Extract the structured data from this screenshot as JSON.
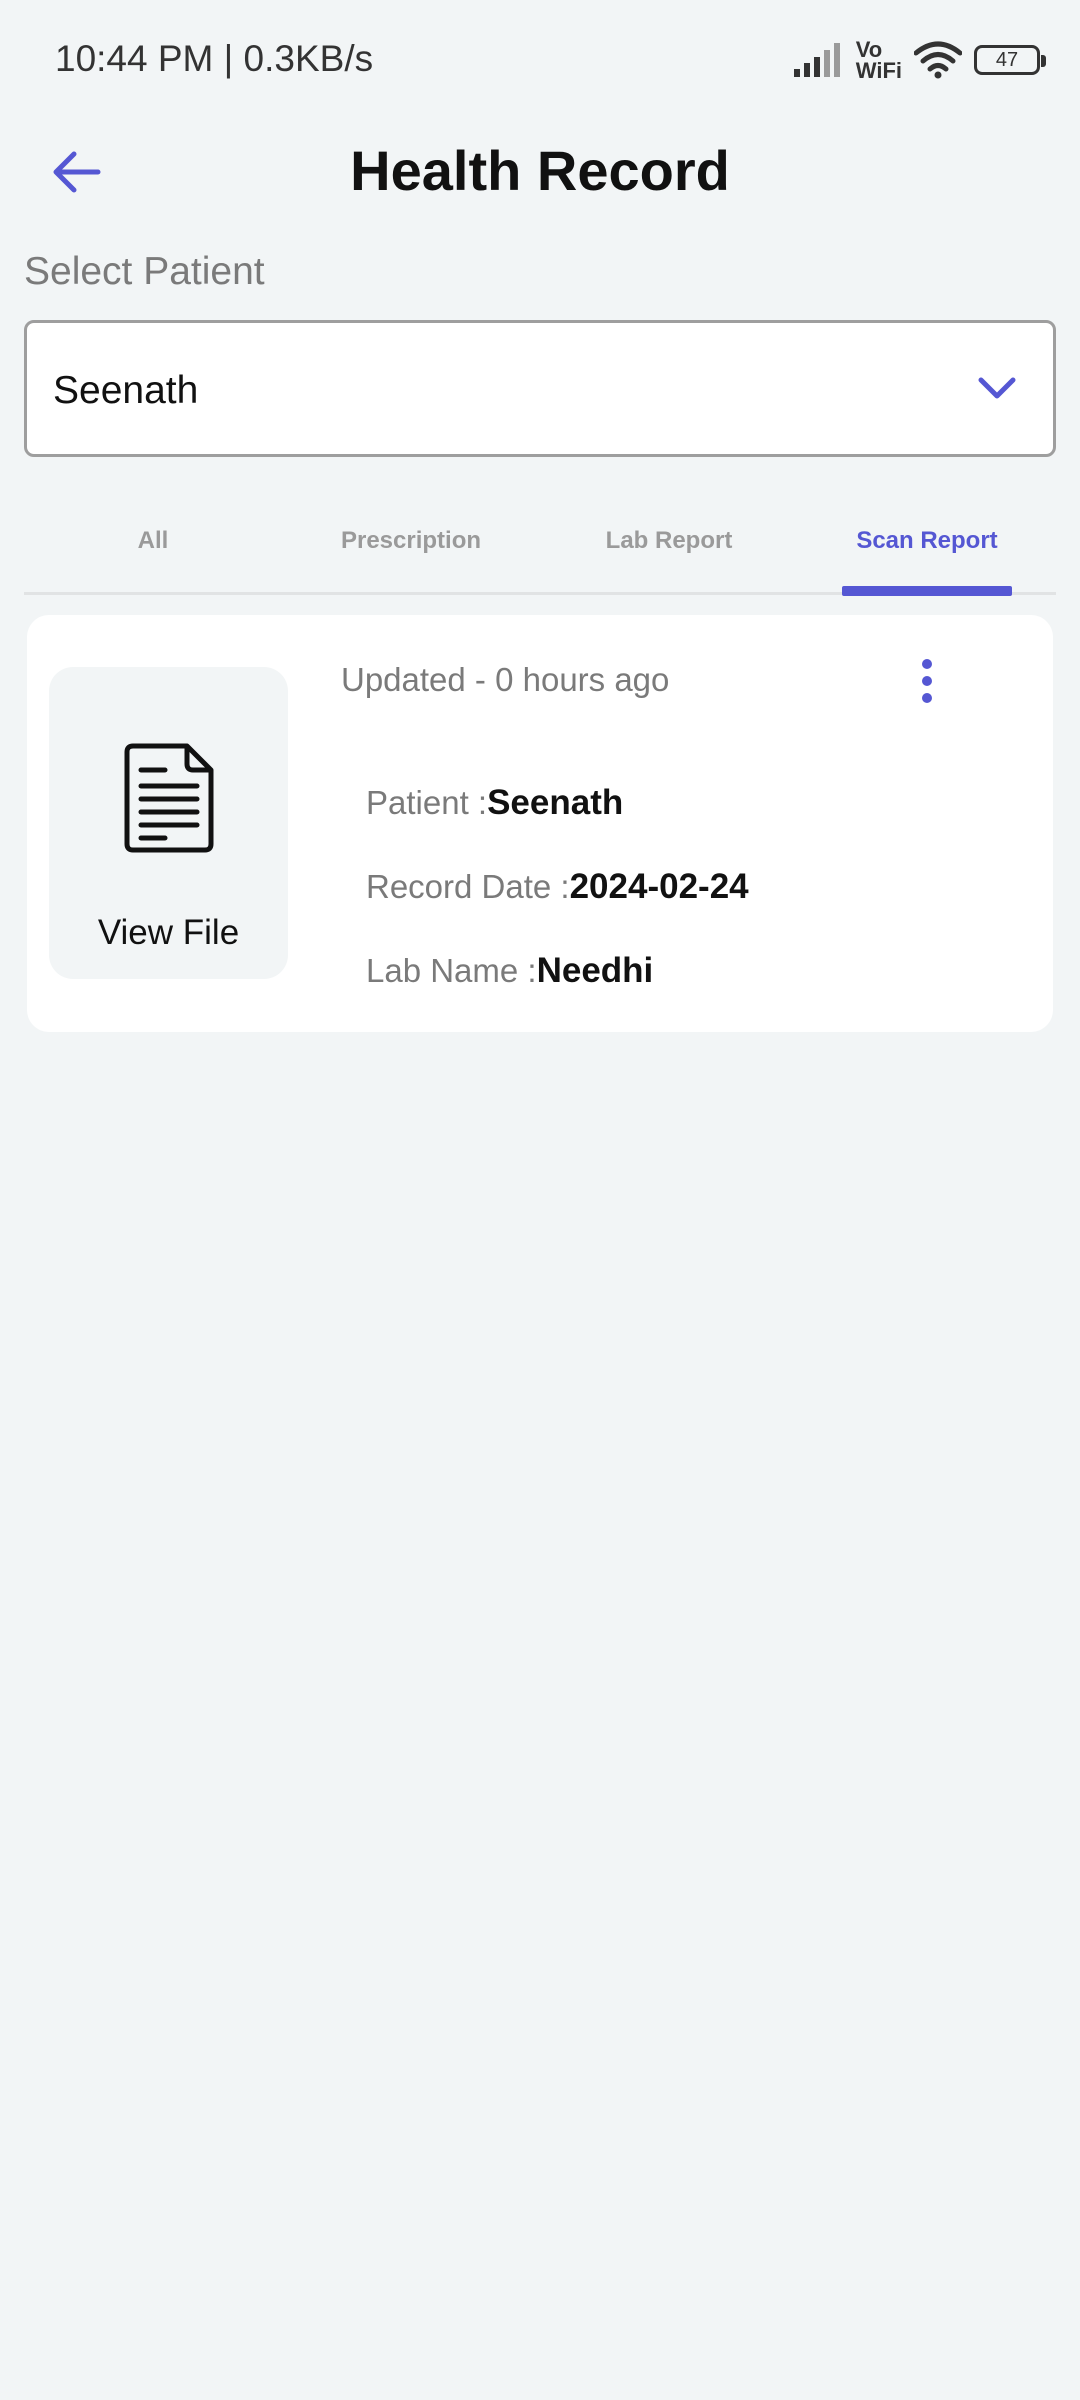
{
  "status_bar": {
    "time": "10:44 PM | 0.3KB/s",
    "vowifi_top": "Vo",
    "vowifi_bottom": "WiFi",
    "battery": "47"
  },
  "header": {
    "title": "Health Record",
    "back_icon": "arrow-left-icon"
  },
  "patient_select": {
    "label": "Select Patient",
    "selected": "Seenath",
    "icon": "chevron-down-icon"
  },
  "tabs": [
    {
      "label": "All"
    },
    {
      "label": "Prescription"
    },
    {
      "label": "Lab Report"
    },
    {
      "label": "Scan Report"
    }
  ],
  "active_tab": "Scan Report",
  "record": {
    "file_label": "View File",
    "file_icon": "document-icon",
    "updated": "Updated - 0 hours ago",
    "patient_label": "Patient :",
    "patient_value": "Seenath",
    "date_label": "Record Date :",
    "date_value": "2024-02-24",
    "lab_label": "Lab Name :",
    "lab_value": "Needhi"
  },
  "colors": {
    "accent": "#5557d3",
    "background": "#f2f5f6",
    "card": "#ffffff",
    "muted_text": "#7a7a7a"
  }
}
